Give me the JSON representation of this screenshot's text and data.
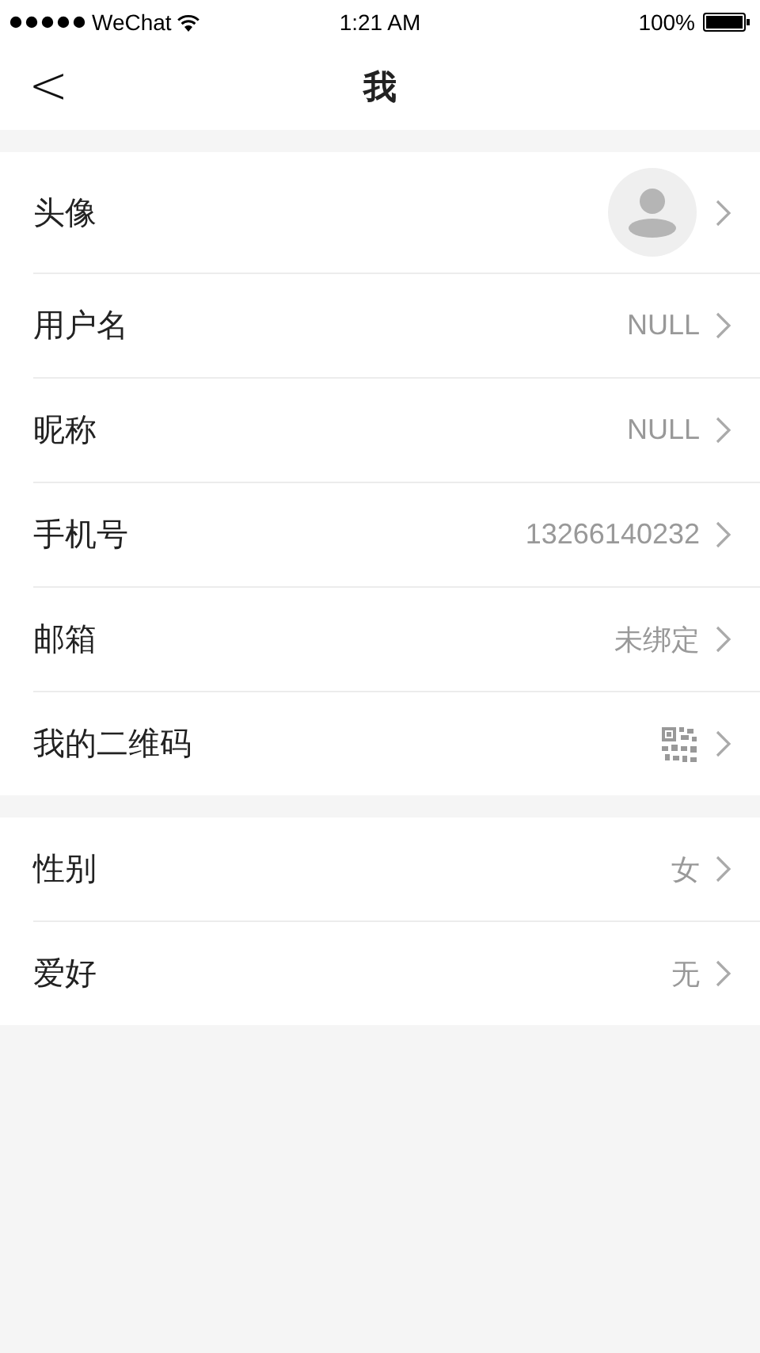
{
  "status_bar": {
    "carrier": "WeChat",
    "time": "1:21 AM",
    "battery": "100%"
  },
  "nav": {
    "back": "<",
    "title": "我"
  },
  "sections": [
    {
      "rows": [
        {
          "kind": "avatar",
          "label": "头像"
        },
        {
          "kind": "text",
          "label": "用户名",
          "value": "NULL"
        },
        {
          "kind": "text",
          "label": "昵称",
          "value": "NULL"
        },
        {
          "kind": "text",
          "label": "手机号",
          "value": "13266140232"
        },
        {
          "kind": "text",
          "label": "邮箱",
          "value": "未绑定"
        },
        {
          "kind": "qr",
          "label": "我的二维码"
        }
      ]
    },
    {
      "rows": [
        {
          "kind": "text",
          "label": "性别",
          "value": "女"
        },
        {
          "kind": "text",
          "label": "爱好",
          "value": "无"
        }
      ]
    }
  ]
}
